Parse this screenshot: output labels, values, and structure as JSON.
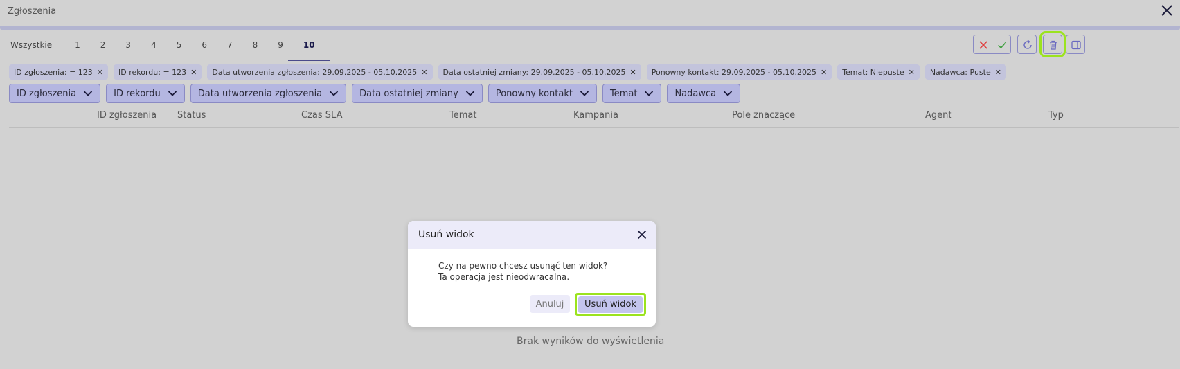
{
  "window": {
    "title": "Zgłoszenia"
  },
  "tabs": [
    "Wszystkie",
    "1",
    "2",
    "3",
    "4",
    "5",
    "6",
    "7",
    "8",
    "9",
    "10"
  ],
  "active_tab": "10",
  "chips": [
    "ID zgłoszenia: = 123",
    "ID rekordu: = 123",
    "Data utworzenia zgłoszenia: 29.09.2025 - 05.10.2025",
    "Data ostatniej zmiany: 29.09.2025 - 05.10.2025",
    "Ponowny kontakt: 29.09.2025 - 05.10.2025",
    "Temat: Niepuste",
    "Nadawca: Puste"
  ],
  "filters": [
    "ID zgłoszenia",
    "ID rekordu",
    "Data utworzenia zgłoszenia",
    "Data ostatniej zmiany",
    "Ponowny kontakt",
    "Temat",
    "Nadawca"
  ],
  "columns": [
    "ID zgłoszenia",
    "Status",
    "Czas SLA",
    "Temat",
    "Kampania",
    "Pole znaczące",
    "Agent",
    "Typ"
  ],
  "empty_message": "Brak wyników do wyświetlenia",
  "modal": {
    "title": "Usuń widok",
    "line1": "Czy na pewno chcesz usunąć ten widok?",
    "line2": "Ta operacja jest nieodwracalna.",
    "cancel_label": "Anuluj",
    "confirm_label": "Usuń widok"
  },
  "colors": {
    "accent": "#8a8ac4",
    "highlight": "#9be31e",
    "cancel_icon": "#e04040",
    "confirm_icon": "#40a040"
  },
  "icons": {
    "cancel": "x-icon",
    "confirm": "check-icon",
    "refresh": "refresh-icon",
    "delete": "trash-icon",
    "panel": "panel-exit-icon"
  }
}
